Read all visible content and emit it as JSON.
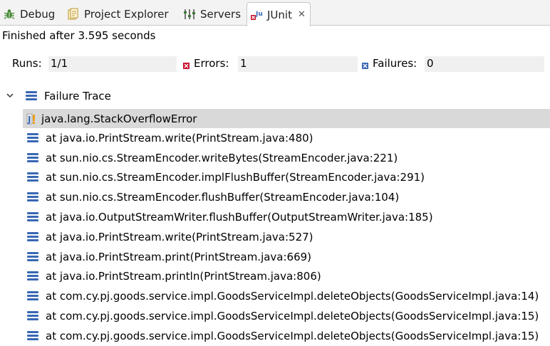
{
  "tabs": [
    {
      "label": "Debug",
      "icon": "bug-icon"
    },
    {
      "label": "Project Explorer",
      "icon": "project-explorer-icon"
    },
    {
      "label": "Servers",
      "icon": "servers-icon"
    },
    {
      "label": "JUnit",
      "icon": "junit-icon",
      "active": true,
      "close": "✕"
    }
  ],
  "status_text": "Finished after 3.595 seconds",
  "counters": {
    "runs_label": "Runs:",
    "runs_value": "1/1",
    "errors_label": "Errors:",
    "errors_value": "1",
    "failures_label": "Failures:",
    "failures_value": "0"
  },
  "trace": {
    "title": "Failure Trace",
    "exception": "java.lang.StackOverflowError",
    "frames": [
      "at java.io.PrintStream.write(PrintStream.java:480)",
      "at sun.nio.cs.StreamEncoder.writeBytes(StreamEncoder.java:221)",
      "at sun.nio.cs.StreamEncoder.implFlushBuffer(StreamEncoder.java:291)",
      "at sun.nio.cs.StreamEncoder.flushBuffer(StreamEncoder.java:104)",
      "at java.io.OutputStreamWriter.flushBuffer(OutputStreamWriter.java:185)",
      "at java.io.PrintStream.write(PrintStream.java:527)",
      "at java.io.PrintStream.print(PrintStream.java:669)",
      "at java.io.PrintStream.println(PrintStream.java:806)",
      "at com.cy.pj.goods.service.impl.GoodsServiceImpl.deleteObjects(GoodsServiceImpl.java:14)",
      "at com.cy.pj.goods.service.impl.GoodsServiceImpl.deleteObjects(GoodsServiceImpl.java:15)",
      "at com.cy.pj.goods.service.impl.GoodsServiceImpl.deleteObjects(GoodsServiceImpl.java:15)"
    ]
  },
  "colors": {
    "accent": "#3868b4",
    "error": "#c8102e",
    "selection": "#d9d9d9"
  }
}
